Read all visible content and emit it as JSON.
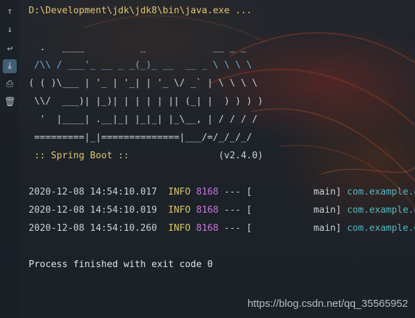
{
  "toolbar": {
    "items": [
      {
        "name": "up-arrow-icon",
        "glyph": "↑"
      },
      {
        "name": "down-arrow-icon",
        "glyph": "↓"
      },
      {
        "name": "soft-wrap-icon",
        "glyph": "↵"
      },
      {
        "name": "scroll-to-end-icon",
        "glyph": "⤓"
      },
      {
        "name": "print-icon",
        "glyph": "⎙"
      },
      {
        "name": "trash-icon",
        "glyph": "🗑"
      }
    ]
  },
  "console": {
    "command": "D:\\Development\\jdk\\jdk8\\bin\\java.exe ...",
    "banner": [
      "  .   ____          _            __ _ _",
      " /\\\\ / ___'_ __ _ _(_)_ __  __ _ \\ \\ \\ \\",
      "( ( )\\___ | '_ | '_| | '_ \\/ _` | \\ \\ \\ \\",
      " \\\\/  ___)| |_)| | | | | || (_| |  ) ) ) )",
      "  '  |____| .__|_| |_|_| |_\\__, | / / / /",
      " =========|_|==============|___/=/_/_/_/"
    ],
    "boot_label": " :: Spring Boot :: ",
    "boot_version": "               (v2.4.0)",
    "logs": [
      {
        "timestamp": "2020-12-08 14:54:10.017",
        "level": "INFO",
        "pid": "8168",
        "sep": " --- [",
        "thread": "           main] ",
        "logger": "com.example.d"
      },
      {
        "timestamp": "2020-12-08 14:54:10.019",
        "level": "INFO",
        "pid": "8168",
        "sep": " --- [",
        "thread": "           main] ",
        "logger": "com.example.d"
      },
      {
        "timestamp": "2020-12-08 14:54:10.260",
        "level": "INFO",
        "pid": "8168",
        "sep": " --- [",
        "thread": "           main] ",
        "logger": "com.example.d"
      }
    ],
    "exit_message": "Process finished with exit code 0"
  },
  "watermark": "https://blog.csdn.net/qq_35565952"
}
